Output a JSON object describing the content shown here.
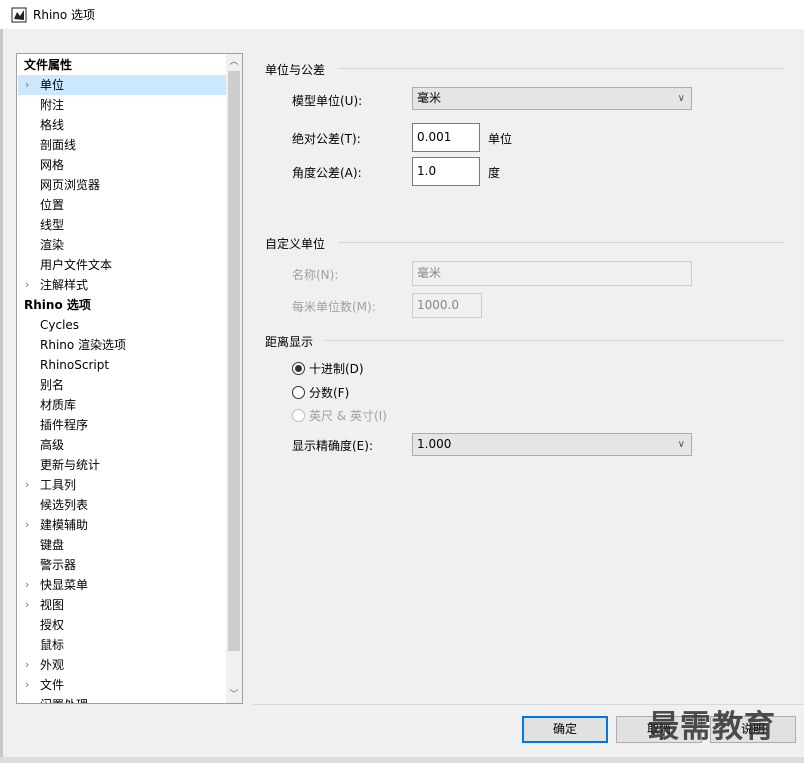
{
  "window": {
    "title": "Rhino 选项",
    "icon": "rhino-app-icon"
  },
  "tree": {
    "items": [
      {
        "label": "文件属性",
        "type": "section",
        "expandable": false
      },
      {
        "label": "单位",
        "type": "item",
        "expandable": true,
        "selected": true
      },
      {
        "label": "附注",
        "type": "item",
        "expandable": false
      },
      {
        "label": "格线",
        "type": "item",
        "expandable": false
      },
      {
        "label": "剖面线",
        "type": "item",
        "expandable": false
      },
      {
        "label": "网格",
        "type": "item",
        "expandable": false
      },
      {
        "label": "网页浏览器",
        "type": "item",
        "expandable": false
      },
      {
        "label": "位置",
        "type": "item",
        "expandable": false
      },
      {
        "label": "线型",
        "type": "item",
        "expandable": false
      },
      {
        "label": "渲染",
        "type": "item",
        "expandable": false
      },
      {
        "label": "用户文件文本",
        "type": "item",
        "expandable": false
      },
      {
        "label": "注解样式",
        "type": "item",
        "expandable": true
      },
      {
        "label": "Rhino 选项",
        "type": "section",
        "expandable": false
      },
      {
        "label": "Cycles",
        "type": "item",
        "expandable": false
      },
      {
        "label": "Rhino 渲染选项",
        "type": "item",
        "expandable": false
      },
      {
        "label": "RhinoScript",
        "type": "item",
        "expandable": false
      },
      {
        "label": "别名",
        "type": "item",
        "expandable": false
      },
      {
        "label": "材质库",
        "type": "item",
        "expandable": false
      },
      {
        "label": "插件程序",
        "type": "item",
        "expandable": false
      },
      {
        "label": "高级",
        "type": "item",
        "expandable": false
      },
      {
        "label": "更新与统计",
        "type": "item",
        "expandable": false
      },
      {
        "label": "工具列",
        "type": "item",
        "expandable": true
      },
      {
        "label": "候选列表",
        "type": "item",
        "expandable": false
      },
      {
        "label": "建模辅助",
        "type": "item",
        "expandable": true
      },
      {
        "label": "键盘",
        "type": "item",
        "expandable": false
      },
      {
        "label": "警示器",
        "type": "item",
        "expandable": false
      },
      {
        "label": "快显菜单",
        "type": "item",
        "expandable": true
      },
      {
        "label": "视图",
        "type": "item",
        "expandable": true
      },
      {
        "label": "授权",
        "type": "item",
        "expandable": false
      },
      {
        "label": "鼠标",
        "type": "item",
        "expandable": false
      },
      {
        "label": "外观",
        "type": "item",
        "expandable": true
      },
      {
        "label": "文件",
        "type": "item",
        "expandable": true
      },
      {
        "label": "闲置处理",
        "type": "item",
        "expandable": false
      }
    ]
  },
  "units_group": {
    "title": "单位与公差",
    "model_units_label": "模型单位(U):",
    "model_units_value": "毫米",
    "abs_tol_label": "绝对公差(T):",
    "abs_tol_value": "0.001",
    "abs_tol_unit": "单位",
    "angle_tol_label": "角度公差(A):",
    "angle_tol_value": "1.0",
    "angle_tol_unit": "度"
  },
  "custom_group": {
    "title": "自定义单位",
    "name_label": "名称(N):",
    "name_value": "毫米",
    "per_meter_label": "每米单位数(M):",
    "per_meter_value": "1000.0"
  },
  "distance_group": {
    "title": "距离显示",
    "options": [
      {
        "label": "十进制(D)",
        "checked": true,
        "disabled": false
      },
      {
        "label": "分数(F)",
        "checked": false,
        "disabled": false
      },
      {
        "label": "英尺 & 英寸(I)",
        "checked": false,
        "disabled": true
      }
    ],
    "precision_label": "显示精确度(E):",
    "precision_value": "1.000"
  },
  "buttons": {
    "ok": "确定",
    "cancel": "取消",
    "help": "说明"
  },
  "watermark": "最需教育"
}
